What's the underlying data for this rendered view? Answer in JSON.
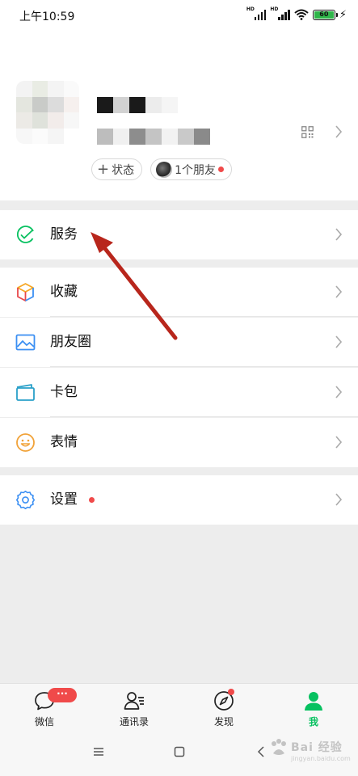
{
  "status_bar": {
    "time": "上午10:59",
    "battery": "60",
    "network_labels": [
      "HD",
      "HD"
    ]
  },
  "profile": {
    "status_tag": "状态",
    "friends_tag": "1个朋友"
  },
  "menu": {
    "services": "服务",
    "favorites": "收藏",
    "moments": "朋友圈",
    "cards": "卡包",
    "stickers": "表情",
    "settings": "设置"
  },
  "tabbar": {
    "chats": "微信",
    "chats_badge": "···",
    "contacts": "通讯录",
    "discover": "发现",
    "me": "我"
  },
  "colors": {
    "accent": "#07c160",
    "badge": "#f04a4a",
    "annotation_arrow": "#b8261c"
  },
  "watermark": {
    "brand": "Bai 经验",
    "url": "jingyan.baidu.com"
  }
}
